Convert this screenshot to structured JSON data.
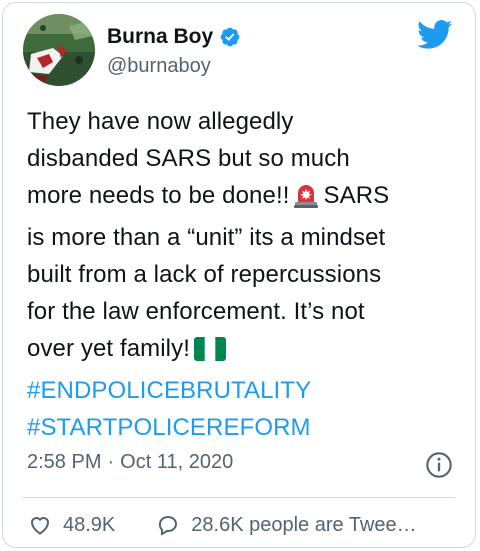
{
  "author": {
    "name": "Burna Boy",
    "handle": "@burnaboy",
    "verified_icon": "verified-badge-icon",
    "platform_icon": "twitter-bird-icon"
  },
  "tweet": {
    "lines": [
      "They have now allegedly",
      "disbanded SARS but so much",
      "more needs to be done!!",
      "SARS",
      "is more than a “unit” its a mindset",
      "built from a lack of repercussions",
      "for the law enforcement. It’s not",
      "over yet family!"
    ],
    "hashtags": [
      "#ENDPOLICEBRUTALITY",
      "#STARTPOLICEREFORM"
    ],
    "emojis": [
      "police-light-emoji",
      "nigeria-flag-emoji"
    ]
  },
  "meta": {
    "time": "2:58 PM",
    "separator": "·",
    "date": "Oct 11, 2020"
  },
  "actions": {
    "likes": "48.9K",
    "replies_label": "28.6K people are Twee…"
  },
  "colors": {
    "link": "#1d9bf0",
    "secondary_text": "#536471",
    "border": "#cfd9de",
    "nigeria_green": "#008751"
  }
}
